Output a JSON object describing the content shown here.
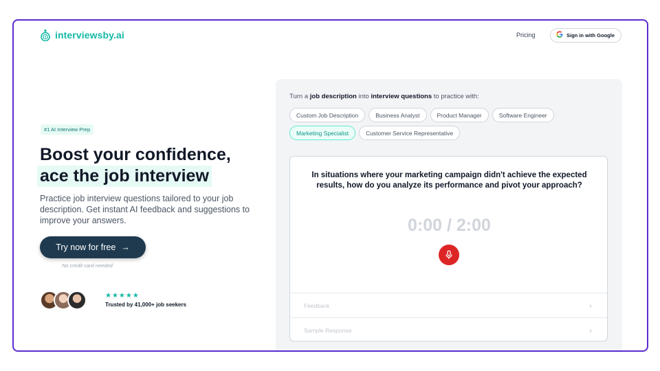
{
  "header": {
    "logo_text": "interviewsby.ai",
    "pricing_label": "Pricing",
    "signin_label": "Sign in with Google",
    "brand_color": "#14b8a6"
  },
  "hero": {
    "badge": "#1 AI Interview Prep",
    "headline_line1": "Boost your confidence,",
    "headline_line2": "ace the job interview",
    "description": "Practice job interview questions tailored to your job description. Get instant AI feedback and suggestions to improve your answers.",
    "cta_label": "Try now for free",
    "cta_arrow": "→",
    "no_card": "No credit card needed",
    "stars": "★★★★★",
    "trusted": "Trusted by 41,000+ job seekers"
  },
  "panel": {
    "intro_pre": "Turn a ",
    "intro_bold1": "job description",
    "intro_mid": " into ",
    "intro_bold2": "interview questions",
    "intro_post": " to practice with:",
    "chips": [
      "Custom Job Description",
      "Business Analyst",
      "Product Manager",
      "Software Engineer",
      "Marketing Specialist",
      "Customer Service Representative"
    ],
    "active_chip": "Marketing Specialist",
    "question": "In situations where your marketing campaign didn't achieve the expected results, how do you analyze its performance and pivot your approach?",
    "timer": "0:00 / 2:00",
    "feedback_label": "Feedback",
    "sample_label": "Sample Response"
  }
}
